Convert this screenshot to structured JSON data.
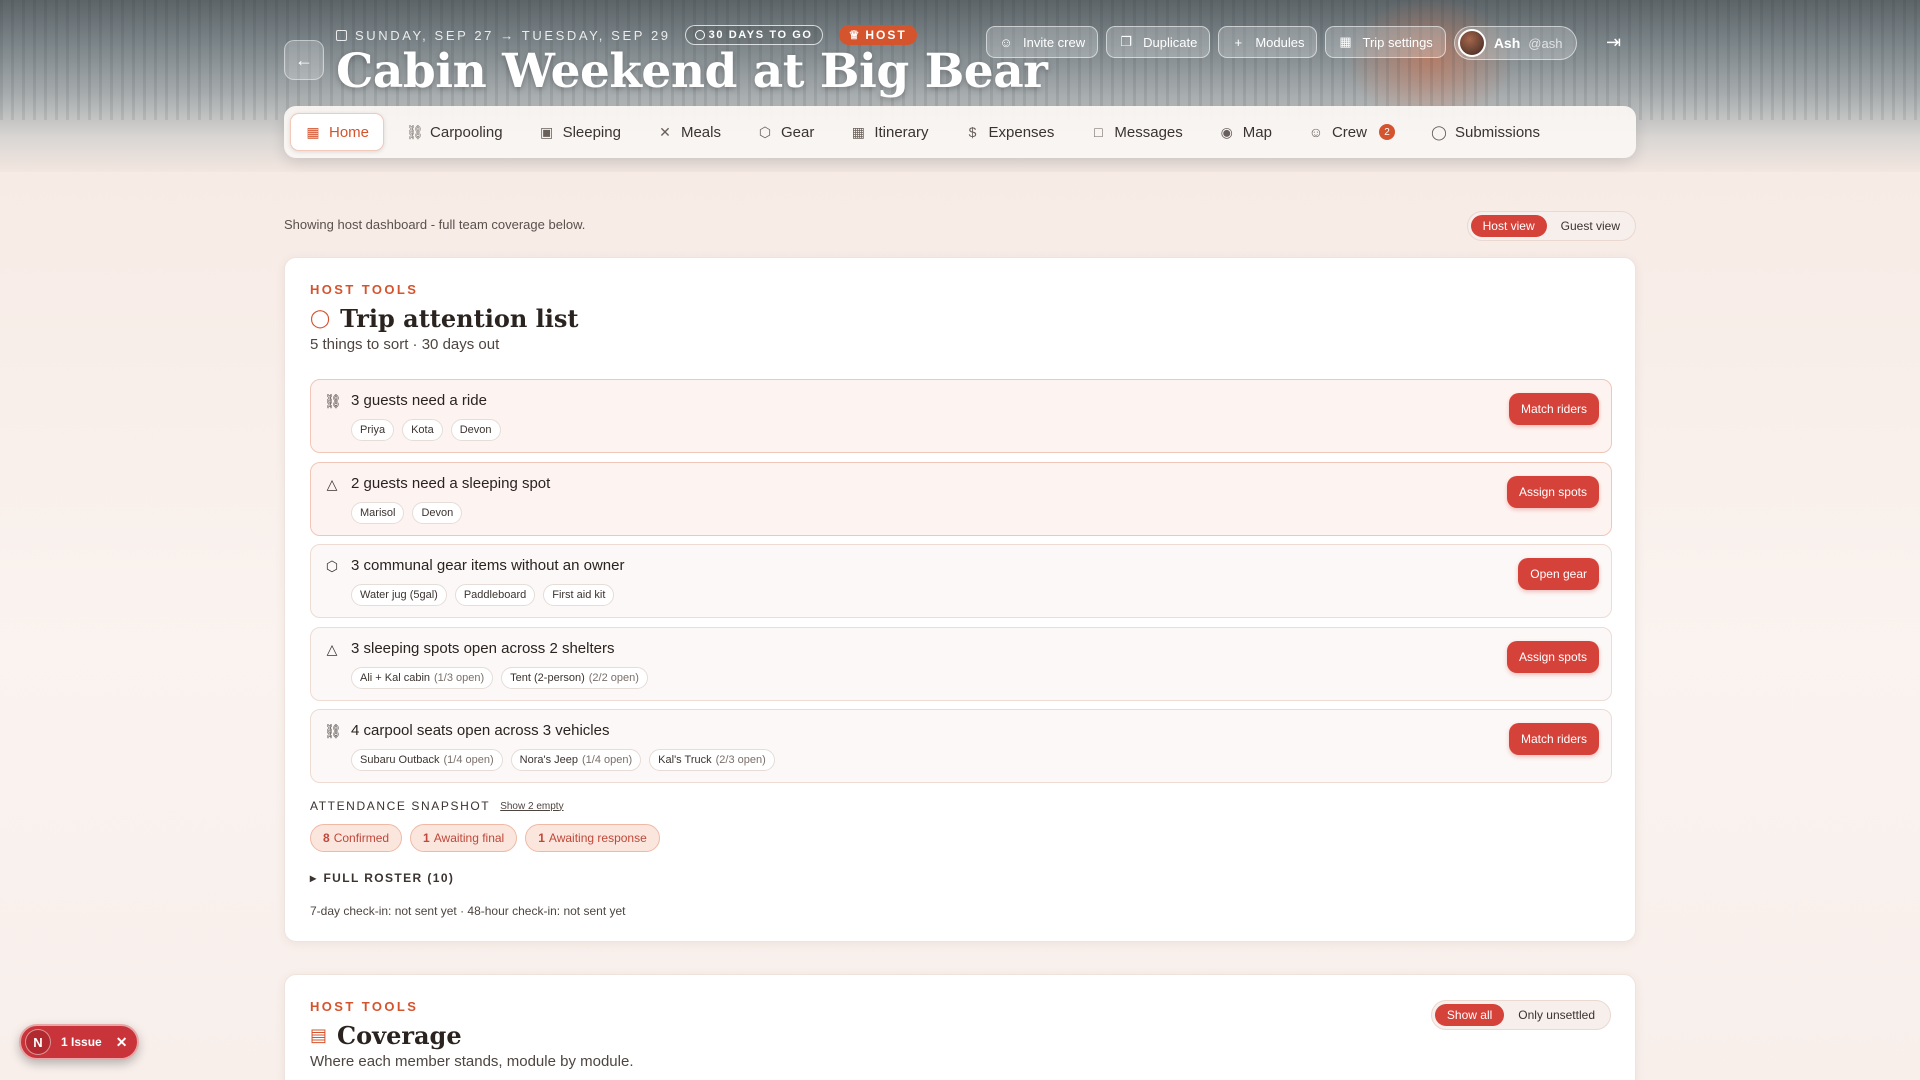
{
  "header": {
    "dates": "SUNDAY, SEP 27 → TUESDAY, SEP 29",
    "countdown": "30 DAYS TO GO",
    "role": "HOST",
    "title": "Cabin Weekend at Big Bear",
    "actions": [
      "Invite crew",
      "Duplicate",
      "Modules",
      "Trip settings"
    ],
    "user": {
      "name": "Ash",
      "handle": "@ash"
    }
  },
  "nav": {
    "items": [
      {
        "label": "Home",
        "icon": "home-grid-icon"
      },
      {
        "label": "Carpooling",
        "icon": "car-icon"
      },
      {
        "label": "Sleeping",
        "icon": "bed-icon"
      },
      {
        "label": "Meals",
        "icon": "utensils-icon"
      },
      {
        "label": "Gear",
        "icon": "box-icon"
      },
      {
        "label": "Itinerary",
        "icon": "calendar-icon"
      },
      {
        "label": "Expenses",
        "icon": "dollar-icon"
      },
      {
        "label": "Messages",
        "icon": "message-icon"
      },
      {
        "label": "Map",
        "icon": "map-pin-icon"
      },
      {
        "label": "Crew",
        "icon": "users-icon",
        "badge": "2"
      },
      {
        "label": "Submissions",
        "icon": "shield-check-icon"
      }
    ],
    "active": "Home"
  },
  "subheader": {
    "showing": "Showing host dashboard - full team coverage below.",
    "view_options": [
      "Host view",
      "Guest view"
    ],
    "selected_view": "Host view"
  },
  "attention": {
    "kicker": "HOST TOOLS",
    "title": "Trip attention list",
    "subtitle": "5 things to sort · 30 days out",
    "items": [
      {
        "icon": "car-icon",
        "title": "3 guests need a ride",
        "action": "Match riders",
        "chips": [
          {
            "label": "Priya"
          },
          {
            "label": "Kota"
          },
          {
            "label": "Devon"
          }
        ]
      },
      {
        "icon": "tent-icon",
        "title": "2 guests need a sleeping spot",
        "action": "Assign spots",
        "chips": [
          {
            "label": "Marisol"
          },
          {
            "label": "Devon"
          }
        ]
      },
      {
        "icon": "box-icon",
        "title": "3 communal gear items without an owner",
        "action": "Open gear",
        "chips": [
          {
            "label": "Water jug (5gal)"
          },
          {
            "label": "Paddleboard"
          },
          {
            "label": "First aid kit"
          }
        ]
      },
      {
        "icon": "tent-icon",
        "title": "3 sleeping spots open across 2 shelters",
        "action": "Assign spots",
        "chips": [
          {
            "label": "Ali + Kal cabin",
            "detail": "(1/3 open)"
          },
          {
            "label": "Tent (2-person)",
            "detail": "(2/2 open)"
          }
        ]
      },
      {
        "icon": "car-icon",
        "title": "4 carpool seats open across 3 vehicles",
        "action": "Match riders",
        "chips": [
          {
            "label": "Subaru Outback",
            "detail": "(1/4 open)"
          },
          {
            "label": "Nora's Jeep",
            "detail": "(1/4 open)"
          },
          {
            "label": "Kal's Truck",
            "detail": "(2/3 open)"
          }
        ]
      }
    ],
    "snapshot_label": "ATTENDANCE SNAPSHOT",
    "snapshot_link": "Show 2 empty",
    "statuses": [
      {
        "count": "8",
        "label": "Confirmed"
      },
      {
        "count": "1",
        "label": "Awaiting final"
      },
      {
        "count": "1",
        "label": "Awaiting response"
      }
    ],
    "roster": "FULL ROSTER (10)",
    "checkin": "7-day check-in: not sent yet · 48-hour check-in: not sent yet"
  },
  "coverage": {
    "kicker": "HOST TOOLS",
    "title": "Coverage",
    "subtitle": "Where each member stands, module by module.",
    "filter_options": [
      "Show all",
      "Only unsettled"
    ],
    "selected_filter": "Show all"
  },
  "issue_badge": {
    "initial": "N",
    "label": "1 Issue"
  },
  "colors": {
    "accent": "#d4542e",
    "button": "#d4423a",
    "issue": "#c9343a"
  }
}
